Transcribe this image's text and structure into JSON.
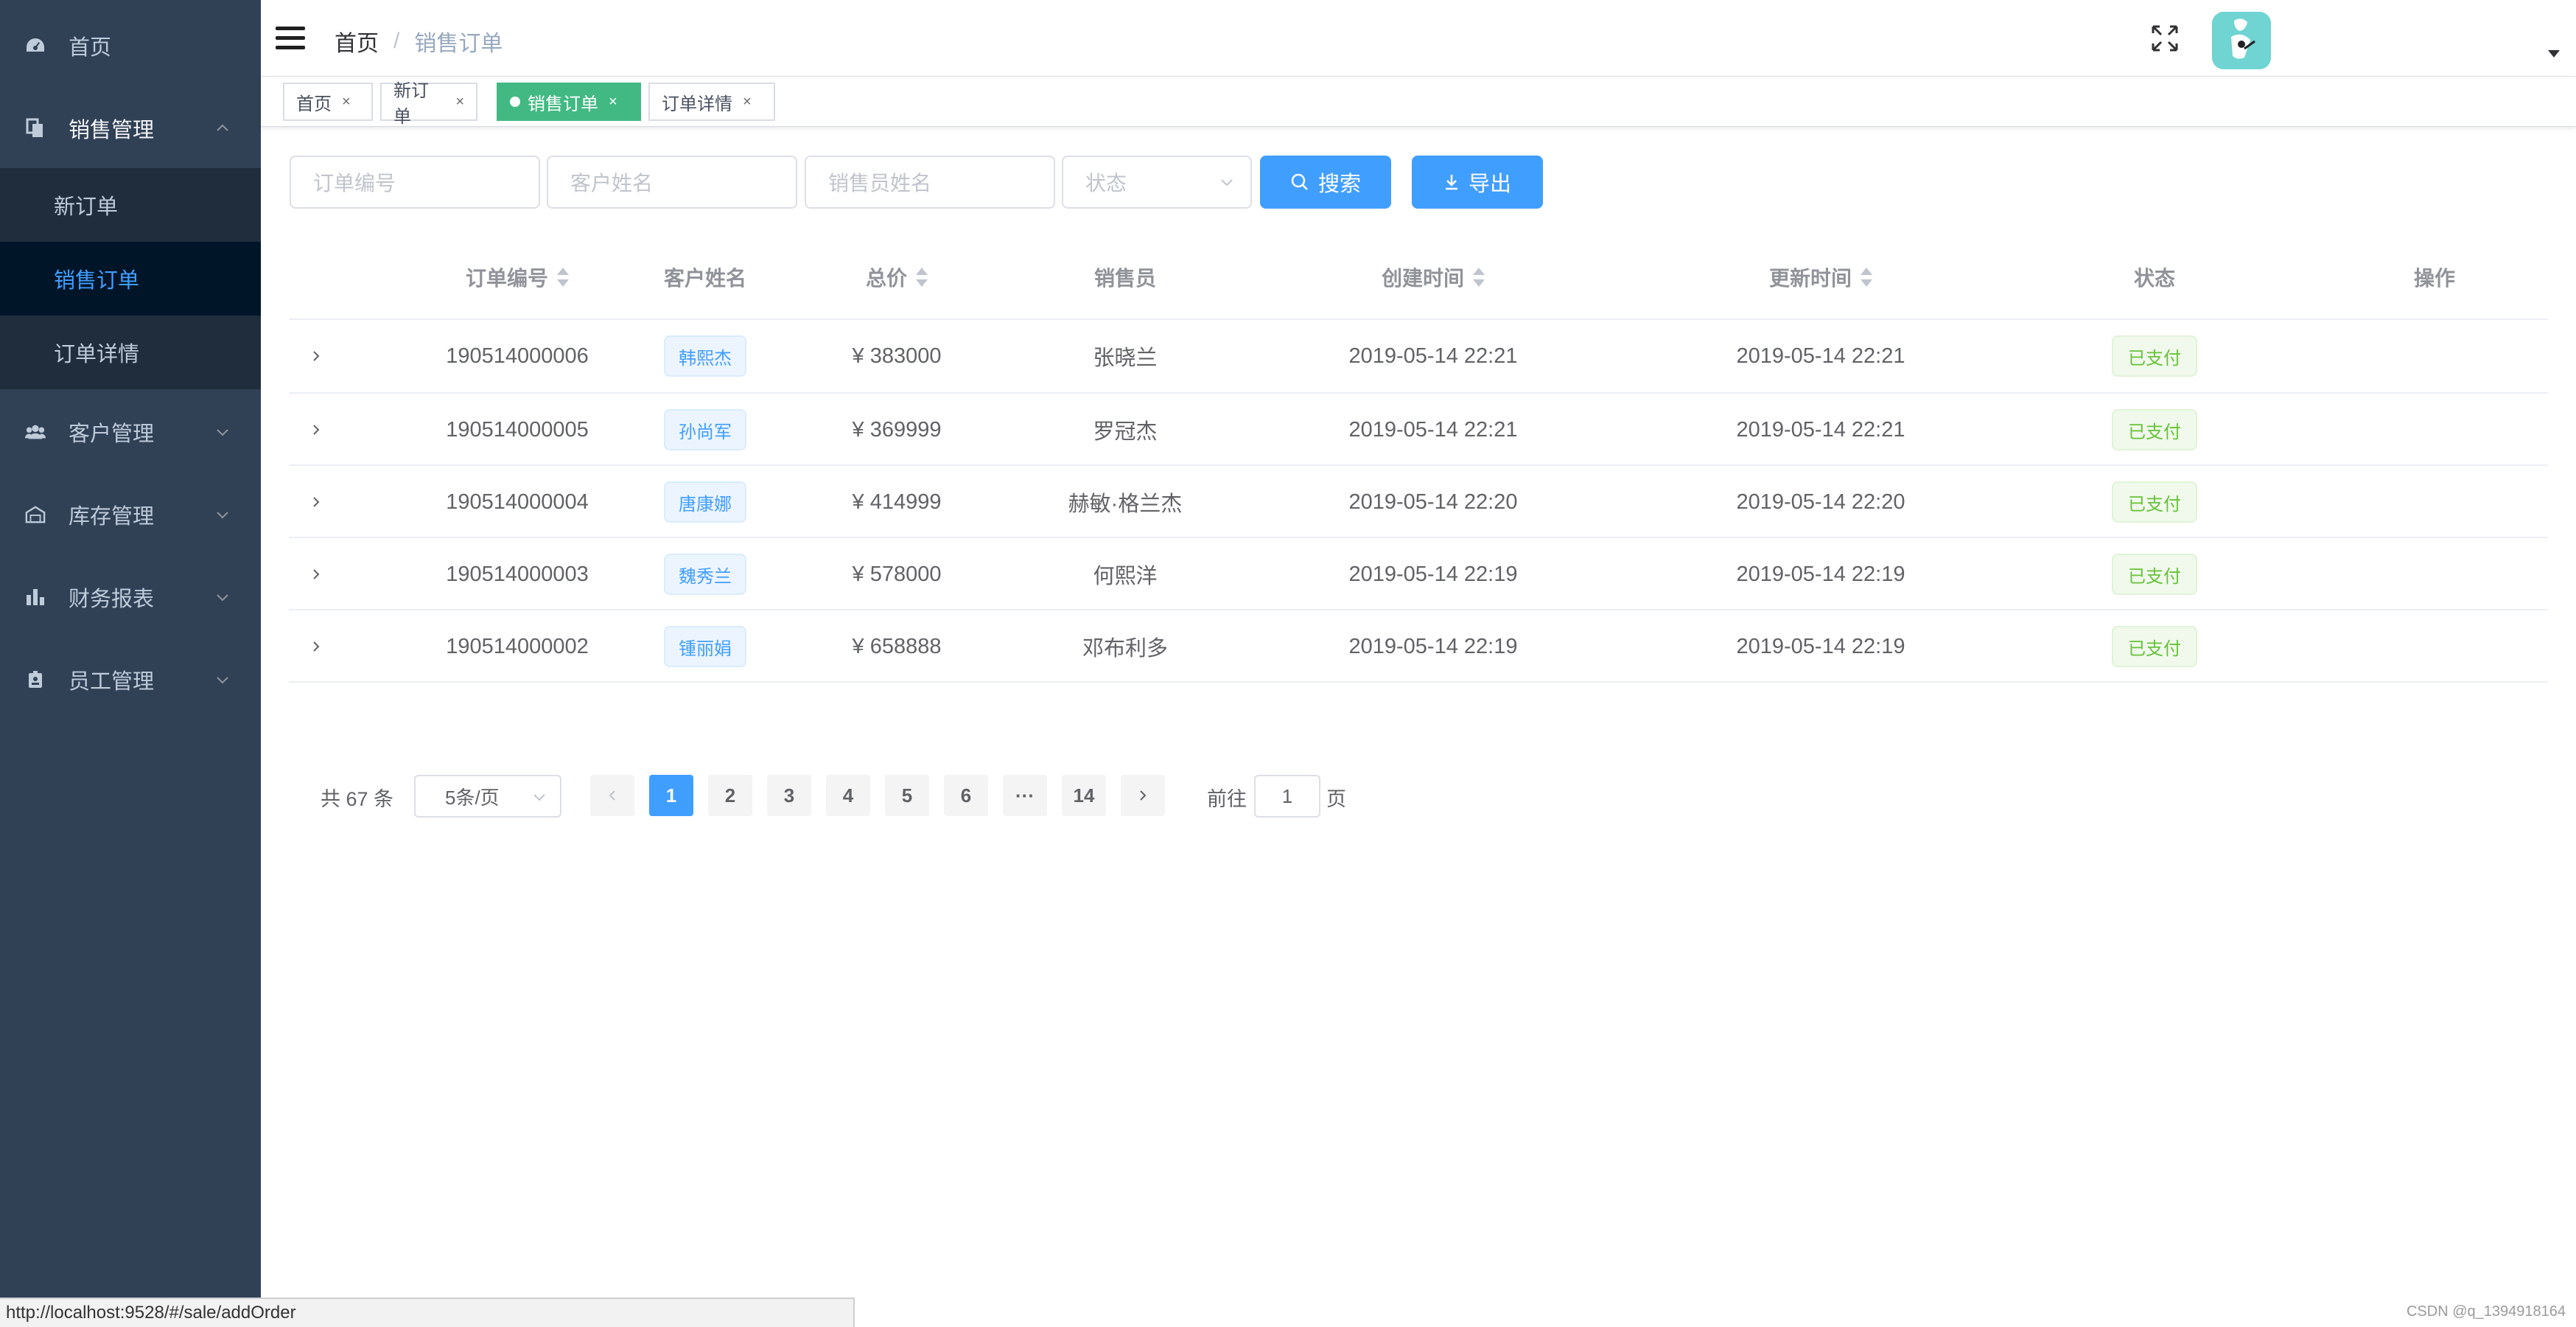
{
  "sidebar": {
    "items": [
      {
        "label": "首页",
        "icon": "dashboard-icon"
      },
      {
        "label": "销售管理",
        "icon": "documents-icon",
        "expanded": true,
        "children": [
          {
            "label": "新订单"
          },
          {
            "label": "销售订单",
            "active": true
          },
          {
            "label": "订单详情"
          }
        ]
      },
      {
        "label": "客户管理",
        "icon": "people-icon"
      },
      {
        "label": "库存管理",
        "icon": "warehouse-icon"
      },
      {
        "label": "财务报表",
        "icon": "bar-chart-icon"
      },
      {
        "label": "员工管理",
        "icon": "badge-icon"
      }
    ]
  },
  "navbar": {
    "breadcrumb": {
      "home": "首页",
      "separator": "/",
      "current": "销售订单"
    },
    "avatar_color": "#6fd4d2"
  },
  "tags": [
    {
      "label": "首页",
      "close": "×"
    },
    {
      "label": "新订单",
      "close": "×"
    },
    {
      "label": "销售订单",
      "close": "×",
      "active": true
    },
    {
      "label": "订单详情",
      "close": "×"
    }
  ],
  "filter": {
    "order_no_placeholder": "订单编号",
    "customer_placeholder": "客户姓名",
    "seller_placeholder": "销售员姓名",
    "status_placeholder": "状态",
    "search_label": "搜索",
    "export_label": "导出"
  },
  "table": {
    "columns": [
      "订单编号",
      "客户姓名",
      "总价",
      "销售员",
      "创建时间",
      "更新时间",
      "状态",
      "操作"
    ],
    "rows": [
      {
        "order_no": "190514000006",
        "customer": "韩熙杰",
        "total": "¥ 383000",
        "seller": "张晓兰",
        "created": "2019-05-14 22:21",
        "updated": "2019-05-14 22:21",
        "status": "已支付"
      },
      {
        "order_no": "190514000005",
        "customer": "孙尚军",
        "total": "¥ 369999",
        "seller": "罗冠杰",
        "created": "2019-05-14 22:21",
        "updated": "2019-05-14 22:21",
        "status": "已支付"
      },
      {
        "order_no": "190514000004",
        "customer": "唐康娜",
        "total": "¥ 414999",
        "seller": "赫敏·格兰杰",
        "created": "2019-05-14 22:20",
        "updated": "2019-05-14 22:20",
        "status": "已支付"
      },
      {
        "order_no": "190514000003",
        "customer": "魏秀兰",
        "total": "¥ 578000",
        "seller": "何熙洋",
        "created": "2019-05-14 22:19",
        "updated": "2019-05-14 22:19",
        "status": "已支付"
      },
      {
        "order_no": "190514000002",
        "customer": "锺丽娟",
        "total": "¥ 658888",
        "seller": "邓布利多",
        "created": "2019-05-14 22:19",
        "updated": "2019-05-14 22:19",
        "status": "已支付"
      }
    ]
  },
  "pagination": {
    "total_text": "共 67 条",
    "page_size": "5条/页",
    "pages": [
      "1",
      "2",
      "3",
      "4",
      "5",
      "6",
      "···",
      "14"
    ],
    "current": "1",
    "goto_label": "前往",
    "goto_value": "1",
    "page_unit": "页"
  },
  "statusbar": {
    "url": "http://localhost:9528/#/sale/addOrder"
  },
  "watermark": "CSDN @q_1394918164",
  "colors": {
    "sidebar_bg": "#304156",
    "primary": "#409eff",
    "active_tag": "#42b983",
    "success": "#67c23a"
  }
}
